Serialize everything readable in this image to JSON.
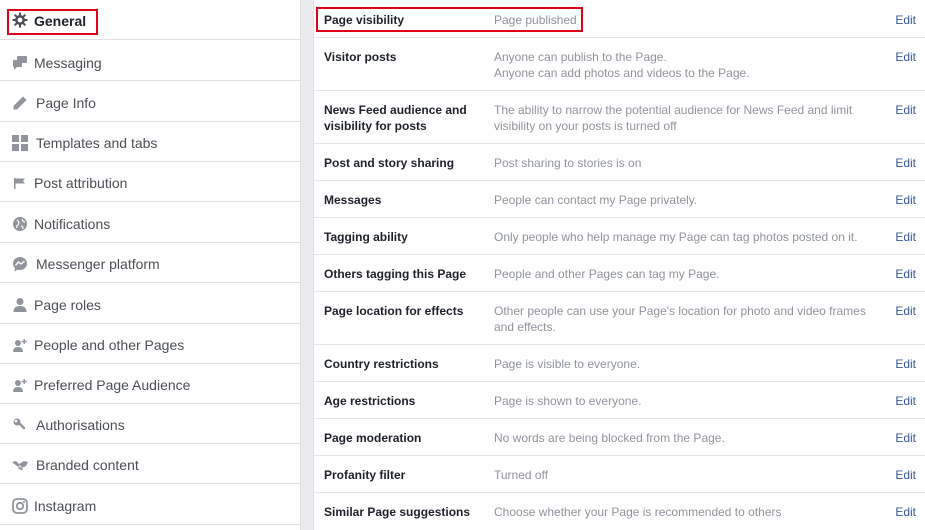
{
  "sidebar": {
    "items": [
      {
        "label": "General",
        "icon": "gear-icon"
      },
      {
        "label": "Messaging",
        "icon": "chat-bubbles-icon"
      },
      {
        "label": "Page Info",
        "icon": "pencil-icon"
      },
      {
        "label": "Templates and tabs",
        "icon": "grid-icon"
      },
      {
        "label": "Post attribution",
        "icon": "flag-icon"
      },
      {
        "label": "Notifications",
        "icon": "globe-icon"
      },
      {
        "label": "Messenger platform",
        "icon": "messenger-icon"
      },
      {
        "label": "Page roles",
        "icon": "person-icon"
      },
      {
        "label": "People and other Pages",
        "icon": "person-add-icon"
      },
      {
        "label": "Preferred Page Audience",
        "icon": "person-add-icon"
      },
      {
        "label": "Authorisations",
        "icon": "wrench-icon"
      },
      {
        "label": "Branded content",
        "icon": "handshake-icon"
      },
      {
        "label": "Instagram",
        "icon": "instagram-icon"
      }
    ]
  },
  "settings": [
    {
      "name": "Page visibility",
      "desc": "Page published",
      "edit": "Edit"
    },
    {
      "name": "Visitor posts",
      "desc": "Anyone can publish to the Page.\nAnyone can add photos and videos to the Page.",
      "edit": "Edit"
    },
    {
      "name": "News Feed audience and visibility for posts",
      "desc": "The ability to narrow the potential audience for News Feed and limit visibility on your posts is turned off",
      "edit": "Edit"
    },
    {
      "name": "Post and story sharing",
      "desc": "Post sharing to stories is on",
      "edit": "Edit"
    },
    {
      "name": "Messages",
      "desc": "People can contact my Page privately.",
      "edit": "Edit"
    },
    {
      "name": "Tagging ability",
      "desc": "Only people who help manage my Page can tag photos posted on it.",
      "edit": "Edit"
    },
    {
      "name": "Others tagging this Page",
      "desc": "People and other Pages can tag my Page.",
      "edit": "Edit"
    },
    {
      "name": "Page location for effects",
      "desc": "Other people can use your Page's location for photo and video frames and effects.",
      "edit": "Edit"
    },
    {
      "name": "Country restrictions",
      "desc": "Page is visible to everyone.",
      "edit": "Edit"
    },
    {
      "name": "Age restrictions",
      "desc": "Page is shown to everyone.",
      "edit": "Edit"
    },
    {
      "name": "Page moderation",
      "desc": "No words are being blocked from the Page.",
      "edit": "Edit"
    },
    {
      "name": "Profanity filter",
      "desc": "Turned off",
      "edit": "Edit"
    },
    {
      "name": "Similar Page suggestions",
      "desc": "Choose whether your Page is recommended to others",
      "edit": "Edit"
    }
  ],
  "colors": {
    "highlight": "#e0001a",
    "link": "#365899",
    "muted_text": "#90949c",
    "icon": "#90949c"
  }
}
